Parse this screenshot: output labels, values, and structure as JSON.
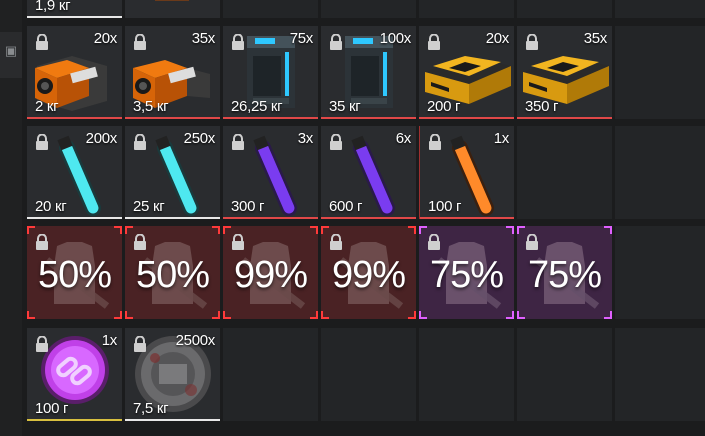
{
  "left_strip": {
    "icon": "box-icon"
  },
  "top_row": {
    "partial_weight": "1,9 кг"
  },
  "colors": {
    "underline_red": "#e04848",
    "underline_white": "#e8e8e8",
    "underline_yellow": "#d8c040",
    "bonus_red": "#ff3a3a",
    "bonus_pink": "#e060ff"
  },
  "row1": [
    {
      "qty": "20x",
      "weight": "2 кг",
      "icon": "orange-crate-icon"
    },
    {
      "qty": "35x",
      "weight": "3,5 кг",
      "icon": "orange-crate-icon"
    },
    {
      "qty": "75x",
      "weight": "26,25 кг",
      "icon": "battery-box-icon"
    },
    {
      "qty": "100x",
      "weight": "35 кг",
      "icon": "battery-box-icon"
    },
    {
      "qty": "20x",
      "weight": "200 г",
      "icon": "gold-case-icon"
    },
    {
      "qty": "35x",
      "weight": "350 г",
      "icon": "gold-case-icon"
    }
  ],
  "row2": [
    {
      "qty": "200x",
      "weight": "20 кг",
      "icon": "cyan-glowstick-icon"
    },
    {
      "qty": "250x",
      "weight": "25 кг",
      "icon": "cyan-glowstick-icon"
    },
    {
      "qty": "3x",
      "weight": "300 г",
      "icon": "purple-glowstick-icon"
    },
    {
      "qty": "6x",
      "weight": "600 г",
      "icon": "purple-glowstick-icon"
    },
    {
      "qty": "1x",
      "weight": "100 г",
      "icon": "orange-glowstick-icon"
    }
  ],
  "row3": [
    {
      "percent": "50%",
      "icon": "vest-gun-icon"
    },
    {
      "percent": "50%",
      "icon": "vest-gun-icon"
    },
    {
      "percent": "99%",
      "icon": "vest-gun-icon"
    },
    {
      "percent": "99%",
      "icon": "vest-gun-icon"
    },
    {
      "percent": "75%",
      "icon": "vest-gun-icon"
    },
    {
      "percent": "75%",
      "icon": "vest-gun-icon"
    }
  ],
  "row4": [
    {
      "qty": "1x",
      "weight": "100 г",
      "icon": "pink-link-token-icon"
    },
    {
      "qty": "2500x",
      "weight": "7,5 кг",
      "icon": "metal-disc-icon"
    }
  ]
}
